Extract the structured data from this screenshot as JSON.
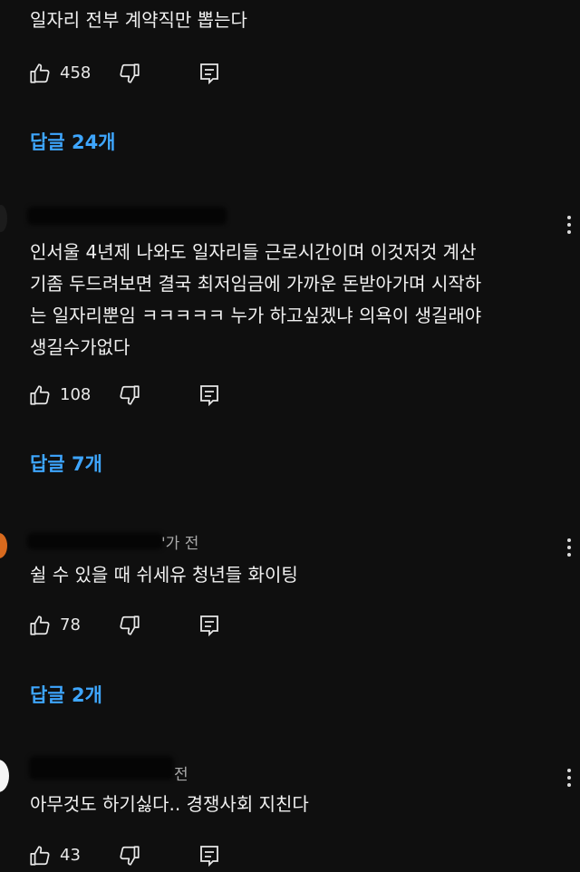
{
  "comments": [
    {
      "text_lines": [
        "일자리 전부 계약직만 뽑는다"
      ],
      "likes": "458",
      "replies": "답글 24개"
    },
    {
      "text_lines": [
        "인서울 4년제 나와도  일자리들  근로시간이며  이것저것  계산",
        "기좀 두드려보면  결국  최저임금에 가까운 돈받아가며 시작하",
        "는 일자리뿐임 ㅋㅋㅋㅋㅋ  누가 하고싶겠냐  의욕이 생길래야",
        "생길수가없다"
      ],
      "likes": "108",
      "replies": "답글 7개"
    },
    {
      "meta": "'가 전",
      "text_lines": [
        "쉴 수 있을 때 쉬세유 청년들 화이팅"
      ],
      "likes": "78",
      "replies": "답글 2개"
    },
    {
      "meta": "전",
      "text_lines": [
        "아무것도 하기싫다.. 경쟁사회 지친다"
      ],
      "likes": "43"
    }
  ],
  "icons": {
    "like": "thumbs-up-icon",
    "dislike": "thumbs-down-icon",
    "reply": "reply-comment-icon",
    "more": "more-vertical-icon"
  },
  "colors": {
    "background": "#0f0f0f",
    "accent": "#3ea6ff",
    "text": "#f1f1f1"
  }
}
